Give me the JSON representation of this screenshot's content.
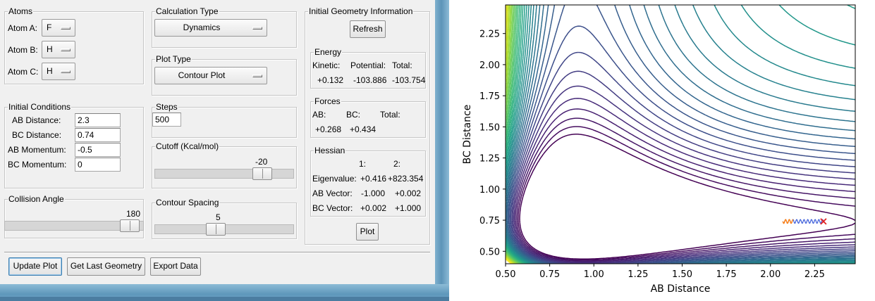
{
  "atoms": {
    "legend": "Atoms",
    "rows": [
      {
        "label": "Atom A:",
        "value": "F"
      },
      {
        "label": "Atom B:",
        "value": "H"
      },
      {
        "label": "Atom C:",
        "value": "H"
      }
    ]
  },
  "calc_type": {
    "legend": "Calculation Type",
    "value": "Dynamics"
  },
  "plot_type": {
    "legend": "Plot Type",
    "value": "Contour Plot"
  },
  "initial_conditions": {
    "legend": "Initial Conditions",
    "rows": [
      {
        "label": "AB Distance:",
        "value": "2.3"
      },
      {
        "label": "BC Distance:",
        "value": "0.74"
      },
      {
        "label": "AB Momentum:",
        "value": "-0.5"
      },
      {
        "label": "BC Momentum:",
        "value": "0"
      }
    ]
  },
  "steps": {
    "legend": "Steps",
    "value": "500"
  },
  "cutoff": {
    "legend": "Cutoff (Kcal/mol)",
    "value": "-20",
    "fraction": 0.82
  },
  "collision": {
    "legend": "Collision Angle",
    "value": "180",
    "fraction": 0.97
  },
  "contour_spacing": {
    "legend": "Contour Spacing",
    "value": "5",
    "fraction": 0.43
  },
  "geometry": {
    "legend": "Initial Geometry Information",
    "refresh_label": "Refresh",
    "plot_label": "Plot",
    "energy": {
      "legend": "Energy",
      "headers": [
        "Kinetic:",
        "Potential:",
        "Total:"
      ],
      "values": [
        "+0.132",
        "-103.886",
        "-103.754"
      ]
    },
    "forces": {
      "legend": "Forces",
      "headers": [
        "AB:",
        "BC:",
        "Total:"
      ],
      "values": [
        "+0.268",
        "+0.434"
      ]
    },
    "hessian": {
      "legend": "Hessian",
      "headers": [
        "1:",
        "2:"
      ],
      "rows": [
        {
          "label": "Eigenvalue:",
          "v1": "+0.416",
          "v2": "+823.354"
        },
        {
          "label": "AB Vector:",
          "v1": "-1.000",
          "v2": "+0.002"
        },
        {
          "label": "BC Vector:",
          "v1": "+0.002",
          "v2": "+1.000"
        }
      ]
    }
  },
  "buttons": {
    "update_plot": "Update Plot",
    "get_last_geometry": "Get Last Geometry",
    "export_data": "Export Data"
  },
  "chart_data": {
    "type": "contour",
    "title": "",
    "xlabel": "AB Distance",
    "ylabel": "BC Distance",
    "xlim": [
      0.5,
      2.48
    ],
    "ylim": [
      0.4,
      2.48
    ],
    "xticks": [
      0.5,
      0.75,
      1.0,
      1.25,
      1.5,
      1.75,
      2.0,
      2.25
    ],
    "yticks": [
      0.5,
      0.75,
      1.0,
      1.25,
      1.5,
      1.75,
      2.0,
      2.25
    ],
    "xtick_labels": [
      "0.50",
      "0.75",
      "1.00",
      "1.25",
      "1.50",
      "1.75",
      "2.00",
      "2.25"
    ],
    "ytick_labels": [
      "0.50",
      "0.75",
      "1.00",
      "1.25",
      "1.50",
      "1.75",
      "2.00",
      "2.25"
    ],
    "colormap": "viridis",
    "trajectory": {
      "color": "#3a5bd9",
      "start_color": "#ff7f0e",
      "end_marker_color": "#e02020",
      "start": [
        2.3,
        0.74
      ],
      "end": [
        2.07,
        0.74
      ]
    }
  }
}
